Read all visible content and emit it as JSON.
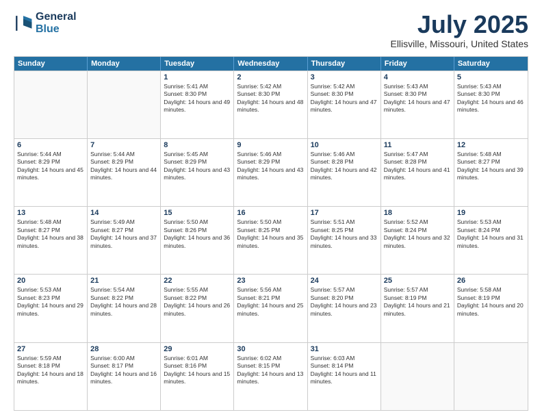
{
  "logo": {
    "line1": "General",
    "line2": "Blue"
  },
  "title": "July 2025",
  "subtitle": "Ellisville, Missouri, United States",
  "headers": [
    "Sunday",
    "Monday",
    "Tuesday",
    "Wednesday",
    "Thursday",
    "Friday",
    "Saturday"
  ],
  "weeks": [
    [
      {
        "day": "",
        "info": ""
      },
      {
        "day": "",
        "info": ""
      },
      {
        "day": "1",
        "info": "Sunrise: 5:41 AM\nSunset: 8:30 PM\nDaylight: 14 hours and 49 minutes."
      },
      {
        "day": "2",
        "info": "Sunrise: 5:42 AM\nSunset: 8:30 PM\nDaylight: 14 hours and 48 minutes."
      },
      {
        "day": "3",
        "info": "Sunrise: 5:42 AM\nSunset: 8:30 PM\nDaylight: 14 hours and 47 minutes."
      },
      {
        "day": "4",
        "info": "Sunrise: 5:43 AM\nSunset: 8:30 PM\nDaylight: 14 hours and 47 minutes."
      },
      {
        "day": "5",
        "info": "Sunrise: 5:43 AM\nSunset: 8:30 PM\nDaylight: 14 hours and 46 minutes."
      }
    ],
    [
      {
        "day": "6",
        "info": "Sunrise: 5:44 AM\nSunset: 8:29 PM\nDaylight: 14 hours and 45 minutes."
      },
      {
        "day": "7",
        "info": "Sunrise: 5:44 AM\nSunset: 8:29 PM\nDaylight: 14 hours and 44 minutes."
      },
      {
        "day": "8",
        "info": "Sunrise: 5:45 AM\nSunset: 8:29 PM\nDaylight: 14 hours and 43 minutes."
      },
      {
        "day": "9",
        "info": "Sunrise: 5:46 AM\nSunset: 8:29 PM\nDaylight: 14 hours and 43 minutes."
      },
      {
        "day": "10",
        "info": "Sunrise: 5:46 AM\nSunset: 8:28 PM\nDaylight: 14 hours and 42 minutes."
      },
      {
        "day": "11",
        "info": "Sunrise: 5:47 AM\nSunset: 8:28 PM\nDaylight: 14 hours and 41 minutes."
      },
      {
        "day": "12",
        "info": "Sunrise: 5:48 AM\nSunset: 8:27 PM\nDaylight: 14 hours and 39 minutes."
      }
    ],
    [
      {
        "day": "13",
        "info": "Sunrise: 5:48 AM\nSunset: 8:27 PM\nDaylight: 14 hours and 38 minutes."
      },
      {
        "day": "14",
        "info": "Sunrise: 5:49 AM\nSunset: 8:27 PM\nDaylight: 14 hours and 37 minutes."
      },
      {
        "day": "15",
        "info": "Sunrise: 5:50 AM\nSunset: 8:26 PM\nDaylight: 14 hours and 36 minutes."
      },
      {
        "day": "16",
        "info": "Sunrise: 5:50 AM\nSunset: 8:25 PM\nDaylight: 14 hours and 35 minutes."
      },
      {
        "day": "17",
        "info": "Sunrise: 5:51 AM\nSunset: 8:25 PM\nDaylight: 14 hours and 33 minutes."
      },
      {
        "day": "18",
        "info": "Sunrise: 5:52 AM\nSunset: 8:24 PM\nDaylight: 14 hours and 32 minutes."
      },
      {
        "day": "19",
        "info": "Sunrise: 5:53 AM\nSunset: 8:24 PM\nDaylight: 14 hours and 31 minutes."
      }
    ],
    [
      {
        "day": "20",
        "info": "Sunrise: 5:53 AM\nSunset: 8:23 PM\nDaylight: 14 hours and 29 minutes."
      },
      {
        "day": "21",
        "info": "Sunrise: 5:54 AM\nSunset: 8:22 PM\nDaylight: 14 hours and 28 minutes."
      },
      {
        "day": "22",
        "info": "Sunrise: 5:55 AM\nSunset: 8:22 PM\nDaylight: 14 hours and 26 minutes."
      },
      {
        "day": "23",
        "info": "Sunrise: 5:56 AM\nSunset: 8:21 PM\nDaylight: 14 hours and 25 minutes."
      },
      {
        "day": "24",
        "info": "Sunrise: 5:57 AM\nSunset: 8:20 PM\nDaylight: 14 hours and 23 minutes."
      },
      {
        "day": "25",
        "info": "Sunrise: 5:57 AM\nSunset: 8:19 PM\nDaylight: 14 hours and 21 minutes."
      },
      {
        "day": "26",
        "info": "Sunrise: 5:58 AM\nSunset: 8:19 PM\nDaylight: 14 hours and 20 minutes."
      }
    ],
    [
      {
        "day": "27",
        "info": "Sunrise: 5:59 AM\nSunset: 8:18 PM\nDaylight: 14 hours and 18 minutes."
      },
      {
        "day": "28",
        "info": "Sunrise: 6:00 AM\nSunset: 8:17 PM\nDaylight: 14 hours and 16 minutes."
      },
      {
        "day": "29",
        "info": "Sunrise: 6:01 AM\nSunset: 8:16 PM\nDaylight: 14 hours and 15 minutes."
      },
      {
        "day": "30",
        "info": "Sunrise: 6:02 AM\nSunset: 8:15 PM\nDaylight: 14 hours and 13 minutes."
      },
      {
        "day": "31",
        "info": "Sunrise: 6:03 AM\nSunset: 8:14 PM\nDaylight: 14 hours and 11 minutes."
      },
      {
        "day": "",
        "info": ""
      },
      {
        "day": "",
        "info": ""
      }
    ]
  ]
}
